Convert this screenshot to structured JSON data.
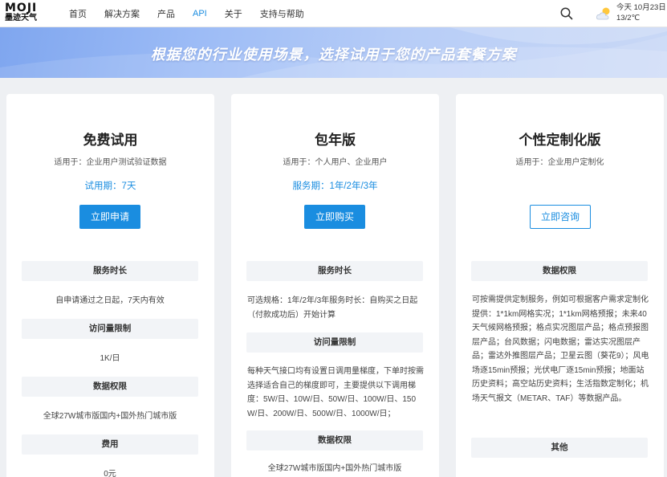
{
  "header": {
    "logo_mark": "MOJI",
    "logo_sub": "墨迹天气",
    "nav": [
      "首页",
      "解决方案",
      "产品",
      "API",
      "关于",
      "支持与帮助"
    ],
    "active_nav": "API",
    "search_icon": "search-icon",
    "weather_icon": "partly-cloudy-icon",
    "date": "今天 10月23日",
    "temp": "13/2℃"
  },
  "banner": {
    "title": "根据您的行业使用场景，选择试用于您的产品套餐方案"
  },
  "plans": [
    {
      "title": "免费试用",
      "applies": "适用于：企业用户测试验证数据",
      "period": "试用期：7天",
      "button": "立即申请",
      "sections": [
        {
          "head": "服务时长",
          "text": "自申请通过之日起，7天内有效"
        },
        {
          "head": "访问量限制",
          "text": "1K/日"
        },
        {
          "head": "数据权限",
          "text": "全球27W城市版国内+国外热门城市版"
        },
        {
          "head": "费用",
          "text": "0元"
        }
      ]
    },
    {
      "title": "包年版",
      "applies": "适用于：个人用户、企业用户",
      "period": "服务期：1年/2年/3年",
      "button": "立即购买",
      "sections": [
        {
          "head": "服务时长",
          "text": "可选规格：1年/2年/3年服务时长：自购买之日起（付款成功后）开始计算"
        },
        {
          "head": "访问量限制",
          "text": "每种天气接口均有设置日调用量梯度，下单时按需选择适合自己的梯度即可，主要提供以下调用梯度：5W/日、10W/日、50W/日、100W/日、150W/日、200W/日、500W/日、1000W/日；"
        },
        {
          "head": "数据权限",
          "text": "全球27W城市版国内+国外热门城市版"
        }
      ]
    },
    {
      "title": "个性定制化版",
      "applies": "适用于：企业用户定制化",
      "button": "立即咨询",
      "sections": [
        {
          "head": "数据权限",
          "text": "可按需提供定制服务，例如可根据客户需求定制化提供：1*1km网格实况；1*1km网格预报；未来40天气候网格预报；格点实况图层产品；格点预报图层产品；台风数据；闪电数据；雷达实况图层产品；雷达外推图层产品；卫星云图（葵花9）；风电场逐15min预报；光伏电厂逐15min预报；地面站历史资料；高空站历史资料；生活指数定制化；机场天气报文（METAR、TAF）等数据产品。"
        },
        {
          "head": "其他",
          "text": ""
        }
      ]
    }
  ],
  "colors": {
    "accent": "#1a8de0",
    "section_bg": "#f2f4f7",
    "page_bg": "#eef0f3"
  }
}
